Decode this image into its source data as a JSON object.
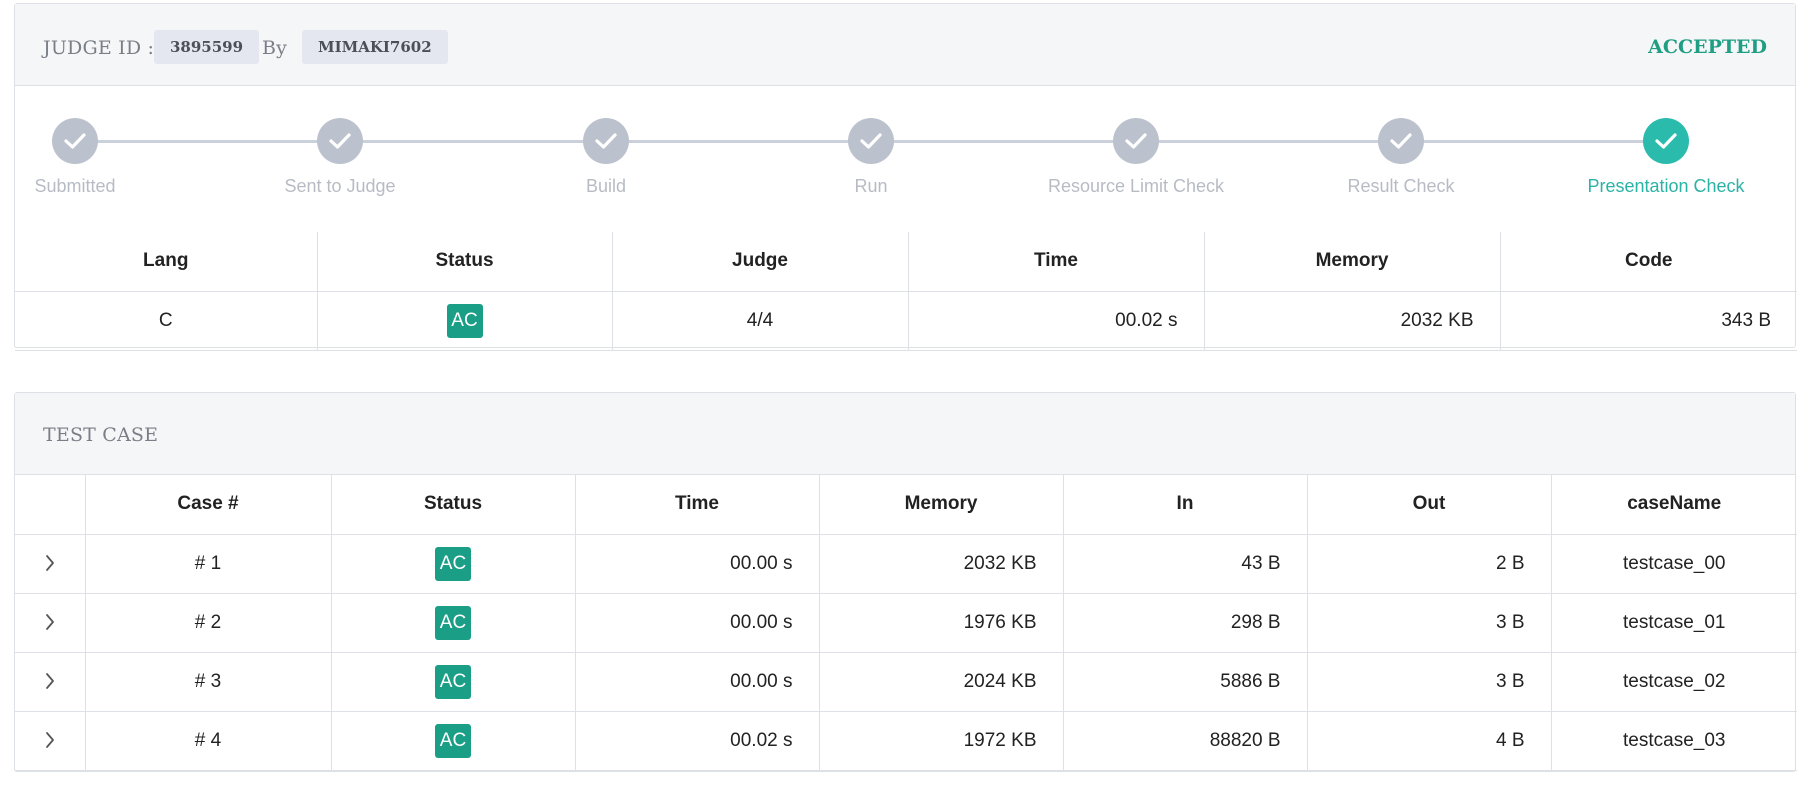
{
  "header": {
    "judge_id_label": "JUDGE ID :",
    "judge_id": "3895599",
    "by_label": "By",
    "user": "MIMAKI7602",
    "verdict": "ACCEPTED",
    "verdict_color": "#1f9e83"
  },
  "steps": [
    {
      "label": "Submitted",
      "icon": "check-icon",
      "active": false
    },
    {
      "label": "Sent to Judge",
      "icon": "check-icon",
      "active": false
    },
    {
      "label": "Build",
      "icon": "check-icon",
      "active": false
    },
    {
      "label": "Run",
      "icon": "check-icon",
      "active": false
    },
    {
      "label": "Resource Limit Check",
      "icon": "check-icon",
      "active": false
    },
    {
      "label": "Result Check",
      "icon": "check-icon",
      "active": false
    },
    {
      "label": "Presentation Check",
      "icon": "check-icon",
      "active": true
    }
  ],
  "summary": {
    "columns": [
      "Lang",
      "Status",
      "Judge",
      "Time",
      "Memory",
      "Code"
    ],
    "row": {
      "lang": "C",
      "status": "AC",
      "judge": "4/4",
      "time": "00.02 s",
      "memory": "2032 KB",
      "code": "343 B"
    }
  },
  "testcase": {
    "title": "TEST CASE",
    "columns": [
      "",
      "Case #",
      "Status",
      "Time",
      "Memory",
      "In",
      "Out",
      "caseName"
    ],
    "rows": [
      {
        "case": "# 1",
        "status": "AC",
        "time": "00.00 s",
        "memory": "2032 KB",
        "in": "43 B",
        "out": "2 B",
        "name": "testcase_00"
      },
      {
        "case": "# 2",
        "status": "AC",
        "time": "00.00 s",
        "memory": "1976 KB",
        "in": "298 B",
        "out": "3 B",
        "name": "testcase_01"
      },
      {
        "case": "# 3",
        "status": "AC",
        "time": "00.00 s",
        "memory": "2024 KB",
        "in": "5886 B",
        "out": "3 B",
        "name": "testcase_02"
      },
      {
        "case": "# 4",
        "status": "AC",
        "time": "00.02 s",
        "memory": "1972 KB",
        "in": "88820 B",
        "out": "4 B",
        "name": "testcase_03"
      }
    ]
  },
  "colors": {
    "ac_badge": "#1a9e86",
    "step_done": "#bcc2cd",
    "step_active": "#2bbbad"
  }
}
